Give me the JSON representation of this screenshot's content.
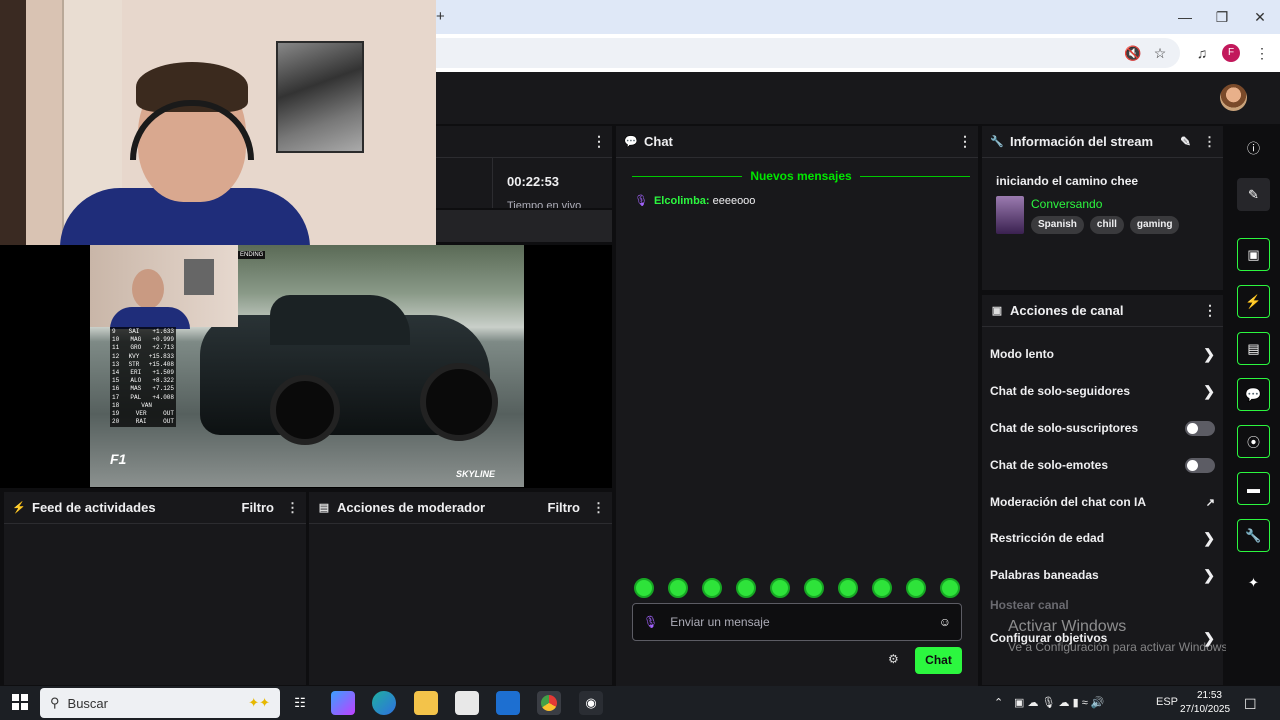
{
  "browser": {
    "new_tab_label": "+",
    "profile_initial": "F"
  },
  "stats": {
    "timer": "00:22:53",
    "timer_label": "Tiempo en vivo"
  },
  "video": {
    "pending_label": "ENDING",
    "f1_logo": "F1",
    "skyline_logo": "SKYLINE",
    "standings": [
      {
        "pos": "9",
        "name": "SAI",
        "gap": "+1.633"
      },
      {
        "pos": "10",
        "name": "MAG",
        "gap": "+0.999"
      },
      {
        "pos": "11",
        "name": "GRO",
        "gap": "+2.713"
      },
      {
        "pos": "12",
        "name": "KVY",
        "gap": "+15.833"
      },
      {
        "pos": "13",
        "name": "STR",
        "gap": "+15.408"
      },
      {
        "pos": "14",
        "name": "ERI",
        "gap": "+1.509"
      },
      {
        "pos": "15",
        "name": "ALO",
        "gap": "+8.322"
      },
      {
        "pos": "16",
        "name": "MAS",
        "gap": "+7.125"
      },
      {
        "pos": "17",
        "name": "PAL",
        "gap": "+4.008"
      },
      {
        "pos": "18",
        "name": "VAN",
        "gap": ""
      },
      {
        "pos": "19",
        "name": "VER",
        "gap": "OUT"
      },
      {
        "pos": "20",
        "name": "RAI",
        "gap": "OUT"
      }
    ]
  },
  "chat": {
    "title": "Chat",
    "new_messages": "Nuevos mensajes",
    "messages": [
      {
        "user": "Elcolimba:",
        "text": "eeeeooo",
        "user_color": "#2cf73f"
      }
    ],
    "input_placeholder": "Enviar un mensaje",
    "send_label": "Chat"
  },
  "stream_info": {
    "title": "Información del stream",
    "stream_title": "iniciando el camino chee",
    "category": "Conversando",
    "tags": [
      "Spanish",
      "chill",
      "gaming"
    ]
  },
  "channel_actions": {
    "title": "Acciones de canal",
    "items": [
      {
        "label": "Modo lento",
        "control": "chevron"
      },
      {
        "label": "Chat de solo-seguidores",
        "control": "chevron"
      },
      {
        "label": "Chat de solo-suscriptores",
        "control": "toggle"
      },
      {
        "label": "Chat de solo-emotes",
        "control": "toggle"
      },
      {
        "label": "Moderación del chat con IA",
        "control": "external"
      },
      {
        "label": "Restricción de edad",
        "control": "chevron"
      },
      {
        "label": "Palabras baneadas",
        "control": "chevron"
      }
    ],
    "host_label": "Hostear canal",
    "goals_label": "Configurar objetivos"
  },
  "windows_watermark": {
    "line1": "Activar Windows",
    "line2": "Ve a Configuración para activar Windows."
  },
  "feed": {
    "title": "Feed de actividades",
    "filter": "Filtro"
  },
  "mod_actions": {
    "title": "Acciones de moderador",
    "filter": "Filtro"
  },
  "taskbar": {
    "search_placeholder": "Buscar",
    "language": "ESP",
    "time": "21:53",
    "date": "27/10/2025"
  },
  "colors": {
    "accent": "#2cf73f",
    "panel": "#18181b",
    "background": "#0e0e10"
  }
}
